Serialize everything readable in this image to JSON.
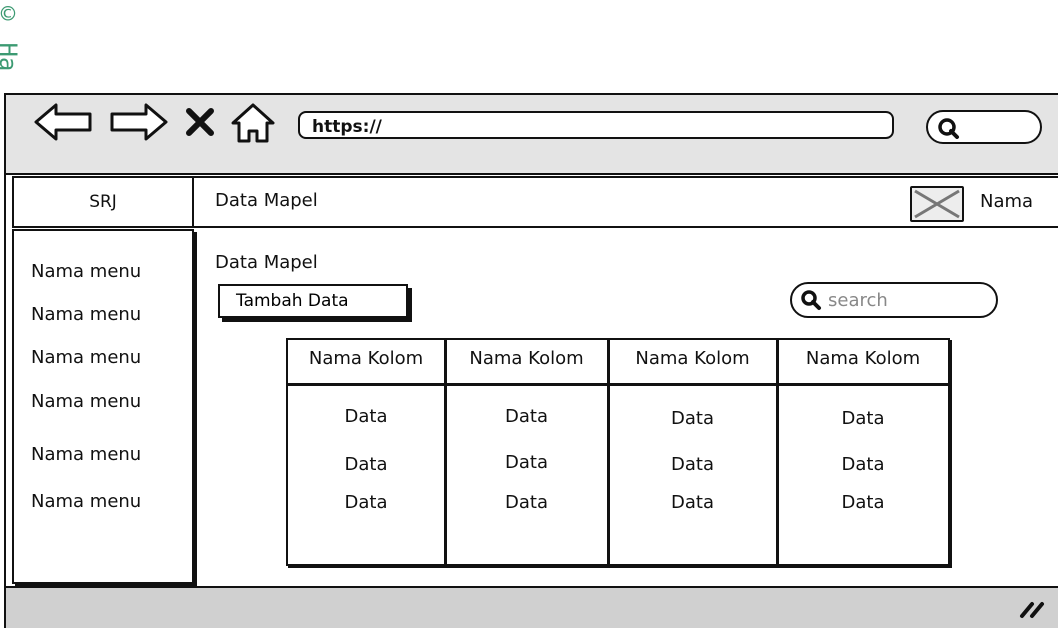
{
  "watermark": "© Ha",
  "browser": {
    "back_icon": "arrow-left-icon",
    "forward_icon": "arrow-right-icon",
    "close_icon": "close-icon",
    "home_icon": "home-icon",
    "url": "https://",
    "search_icon": "search-icon"
  },
  "brand": "SRJ",
  "header": {
    "title": "Data Mapel",
    "user_name": "Nama",
    "avatar_icon": "image-placeholder-icon"
  },
  "sidebar": {
    "items": [
      {
        "label": "Nama menu"
      },
      {
        "label": "Nama menu"
      },
      {
        "label": "Nama menu"
      },
      {
        "label": "Nama menu"
      },
      {
        "label": "Nama menu"
      },
      {
        "label": "Nama menu"
      }
    ]
  },
  "content": {
    "title": "Data Mapel",
    "add_button": "Tambah Data",
    "search_placeholder": "search"
  },
  "table": {
    "columns": [
      "Nama Kolom",
      "Nama Kolom",
      "Nama Kolom",
      "Nama Kolom"
    ],
    "rows": [
      [
        "Data",
        "Data",
        "Data",
        "Data"
      ],
      [
        "Data",
        "Data",
        "Data",
        "Data"
      ],
      [
        "Data",
        "Data",
        "Data",
        "Data"
      ]
    ]
  },
  "colors": {
    "border": "#111111",
    "topbar": "#e4e4e4",
    "footer": "#d0d0d0",
    "watermark": "#3c9a72"
  }
}
